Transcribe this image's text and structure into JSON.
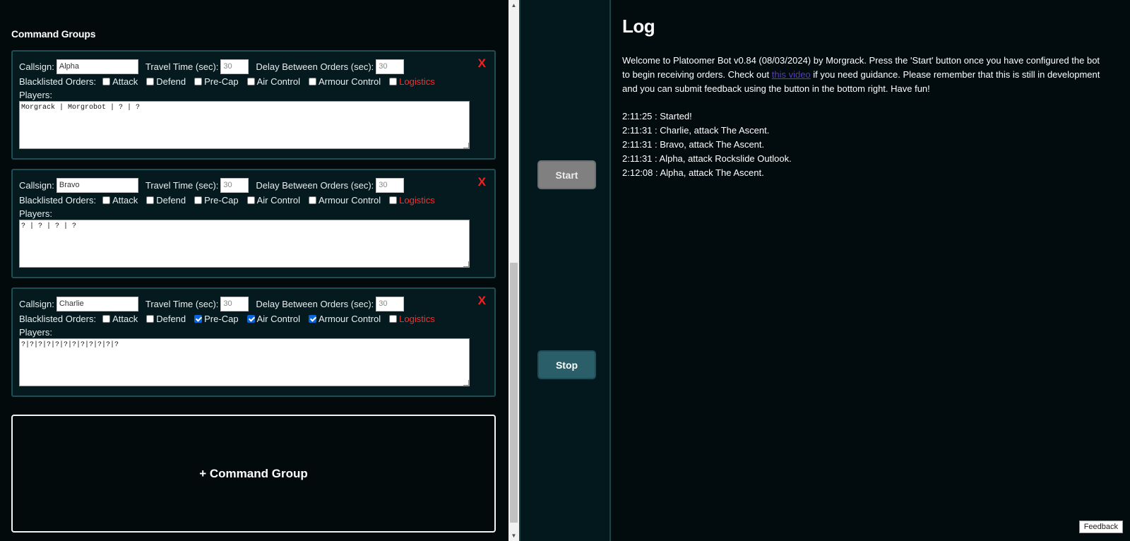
{
  "left": {
    "section_title": "Command Groups",
    "labels": {
      "callsign": "Callsign:",
      "travel_time": "Travel Time (sec):",
      "delay": "Delay Between Orders (sec):",
      "blacklisted": "Blacklisted Orders:",
      "players": "Players:"
    },
    "order_names": [
      "Attack",
      "Defend",
      "Pre-Cap",
      "Air Control",
      "Armour Control",
      "Logistics"
    ],
    "remove_symbol": "X",
    "groups": [
      {
        "callsign": "Alpha",
        "travel_time_placeholder": "30",
        "delay_placeholder": "30",
        "blacklist": [
          false,
          false,
          false,
          false,
          false,
          false
        ],
        "players": "Morgrack | Morgrobot | ? | ?"
      },
      {
        "callsign": "Bravo",
        "travel_time_placeholder": "30",
        "delay_placeholder": "30",
        "blacklist": [
          false,
          false,
          false,
          false,
          false,
          false
        ],
        "players": "? | ? | ? | ?"
      },
      {
        "callsign": "Charlie",
        "travel_time_placeholder": "30",
        "delay_placeholder": "30",
        "blacklist": [
          false,
          false,
          true,
          true,
          true,
          false
        ],
        "players": "?|?|?|?|?|?|?|?|?|?|?|?"
      }
    ],
    "add_group_label": "+ Command Group"
  },
  "controls": {
    "start_label": "Start",
    "stop_label": "Stop"
  },
  "log": {
    "title": "Log",
    "welcome_before": "Welcome to Platoomer Bot v0.84 (08/03/2024) by Morgrack. Press the 'Start' button once you have configured the bot to begin receiving orders. Check out ",
    "welcome_link": "this video",
    "welcome_after": " if you need guidance. Please remember that this is still in development and you can submit feedback using the button in the bottom right. Have fun!",
    "entries": [
      "2:11:25 : Started!",
      "2:11:31 : Charlie, attack The Ascent.",
      "2:11:31 : Bravo, attack The Ascent.",
      "2:11:31 : Alpha, attack Rockslide Outlook.",
      "2:12:08 : Alpha, attack The Ascent."
    ],
    "feedback_label": "Feedback"
  },
  "colors": {
    "background": "#020b0d",
    "card": "#051a1e",
    "card_border": "#1e4e54",
    "logistics_red": "#ff2b2b",
    "stop_button": "#2a5f6a",
    "start_button": "#808080",
    "link": "#5a3dbd"
  }
}
